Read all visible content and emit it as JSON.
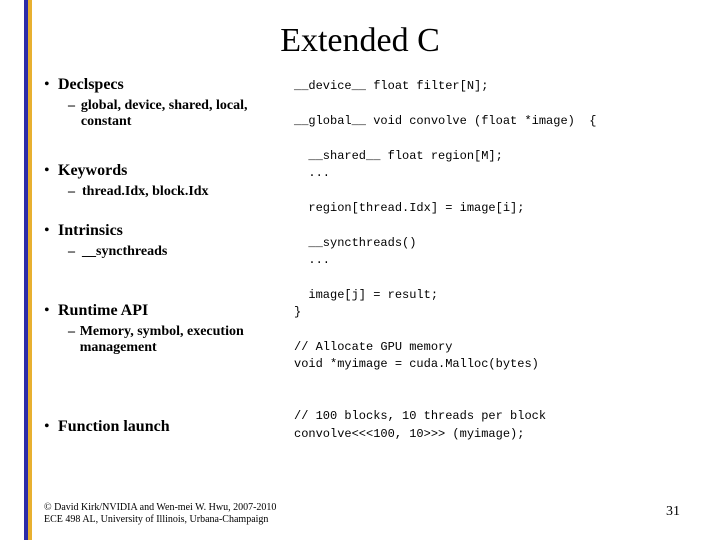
{
  "title": "Extended C",
  "sections": [
    {
      "heading": "Declspecs",
      "sub": "global, device, shared, local, constant"
    },
    {
      "heading": "Keywords",
      "sub": "thread.Idx, block.Idx"
    },
    {
      "heading": "Intrinsics",
      "sub": "__syncthreads"
    },
    {
      "heading": "Runtime API",
      "sub": "Memory, symbol, execution management"
    },
    {
      "heading": "Function launch",
      "sub": ""
    }
  ],
  "code": {
    "l1": "__device__ float filter[N];",
    "l2": "__global__ void convolve (float *image)  {",
    "l3": "  __shared__ float region[M];",
    "l4": "  ...",
    "l5": "  region[thread.Idx] = image[i];",
    "l6": "  __syncthreads()",
    "l7": "  ...",
    "l8": "  image[j] = result;",
    "l9": "}",
    "l10": "// Allocate GPU memory",
    "l11": "void *myimage = cuda.Malloc(bytes)",
    "l12": "// 100 blocks, 10 threads per block",
    "l13": "convolve<<<100, 10>>> (myimage);"
  },
  "footer": {
    "line1": "© David Kirk/NVIDIA and Wen-mei W. Hwu, 2007-2010",
    "line2": "ECE 498 AL, University of Illinois, Urbana-Champaign"
  },
  "page_number": "31"
}
